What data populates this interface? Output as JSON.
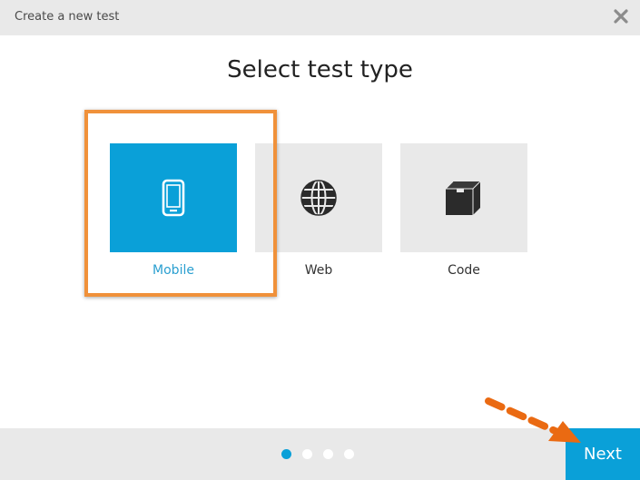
{
  "dialog": {
    "title": "Create a new test",
    "close_icon": "close-icon"
  },
  "main": {
    "heading": "Select test type",
    "test_types": [
      {
        "label": "Mobile",
        "icon": "mobile-phone-icon",
        "selected": true
      },
      {
        "label": "Web",
        "icon": "globe-icon",
        "selected": false
      },
      {
        "label": "Code",
        "icon": "box-icon",
        "selected": false
      }
    ]
  },
  "footer": {
    "steps_total": 4,
    "current_step": 1,
    "next_label": "Next"
  },
  "colors": {
    "accent": "#0aa0d8",
    "highlight": "#f0913a",
    "arrow": "#ea6a12",
    "tile_bg": "#e9e9e9"
  }
}
